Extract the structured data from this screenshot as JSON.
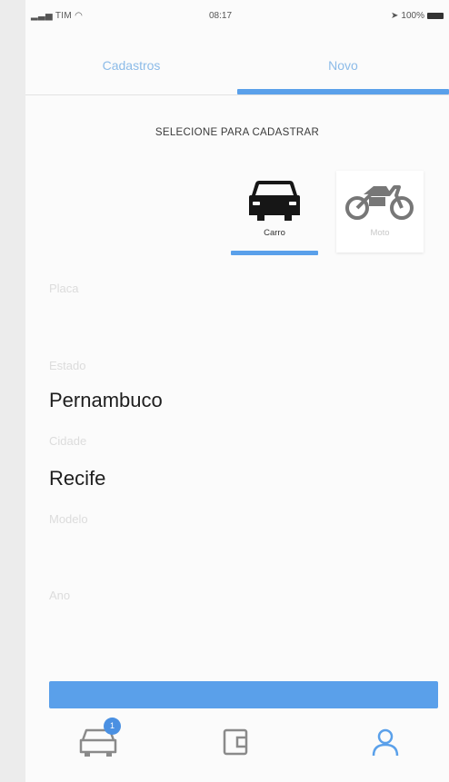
{
  "status_bar": {
    "carrier": "TIM",
    "time": "08:17",
    "battery": "100%"
  },
  "tabs": [
    {
      "label": "Cadastros",
      "active": false
    },
    {
      "label": "Novo",
      "active": true
    }
  ],
  "section_title": "SELECIONE PARA CADASTRAR",
  "vehicles": [
    {
      "label": "Carro",
      "icon": "car-icon",
      "selected": true
    },
    {
      "label": "Moto",
      "icon": "motorcycle-icon",
      "selected": false
    }
  ],
  "form": {
    "plate": {
      "label": "Placa",
      "value": ""
    },
    "state": {
      "label": "Estado",
      "value": "Pernambuco"
    },
    "city": {
      "label": "Cidade",
      "value": "Recife"
    },
    "model": {
      "label": "Modelo",
      "value": ""
    },
    "year": {
      "label": "Ano",
      "value": ""
    }
  },
  "submit": {
    "label": ""
  },
  "bottom_nav": [
    {
      "label": "",
      "icon": "car-outline-icon",
      "badge": "1",
      "active": false
    },
    {
      "label": "",
      "icon": "wallet-icon",
      "active": false
    },
    {
      "label": "",
      "icon": "user-icon",
      "active": true
    }
  ],
  "colors": {
    "accent": "#5aa0ea",
    "accent_light": "#8cbbe8",
    "text_dark": "#1e1e1e",
    "muted": "#dcdcdc"
  }
}
